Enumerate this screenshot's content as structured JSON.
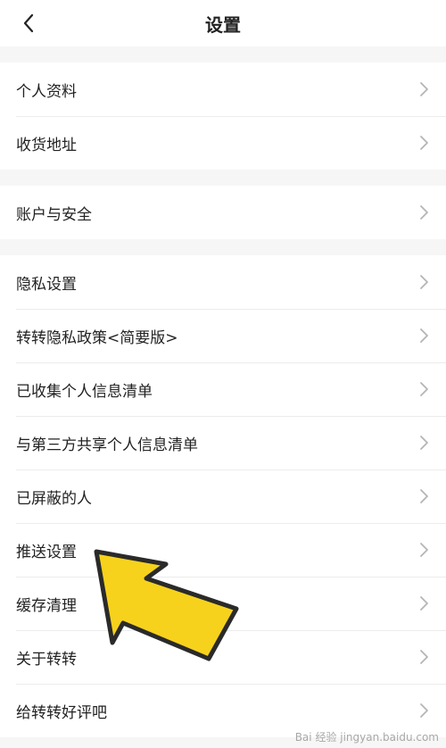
{
  "header": {
    "title": "设置",
    "back_icon": "chevron-left-icon"
  },
  "groups": [
    {
      "items": [
        {
          "label": "个人资料"
        },
        {
          "label": "收货地址"
        }
      ]
    },
    {
      "items": [
        {
          "label": "账户与安全"
        }
      ]
    },
    {
      "items": [
        {
          "label": "隐私设置"
        },
        {
          "label": "转转隐私政策<简要版>"
        },
        {
          "label": "已收集个人信息清单"
        },
        {
          "label": "与第三方共享个人信息清单"
        },
        {
          "label": "已屏蔽的人"
        },
        {
          "label": "推送设置"
        },
        {
          "label": "缓存清理"
        },
        {
          "label": "关于转转"
        },
        {
          "label": "给转转好评吧"
        }
      ]
    }
  ],
  "colors": {
    "arrow_fill": "#f7d21c",
    "arrow_stroke": "#2a2a2a"
  },
  "watermark": "Bai 经验 jingyan.baidu.com"
}
